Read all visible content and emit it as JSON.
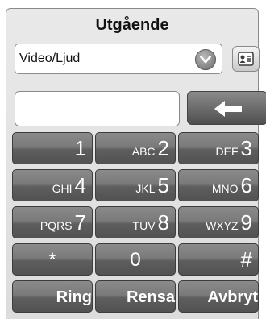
{
  "title": "Utgående",
  "call_type": {
    "selected": "Video/Ljud"
  },
  "number_input": {
    "value": "",
    "placeholder": ""
  },
  "icons": {
    "dropdown": "chevron-down-icon",
    "contacts": "contact-card-icon",
    "backspace": "backspace-arrow-icon"
  },
  "keypad": {
    "k1": {
      "letters": "",
      "digit": "1"
    },
    "k2": {
      "letters": "ABC",
      "digit": "2"
    },
    "k3": {
      "letters": "DEF",
      "digit": "3"
    },
    "k4": {
      "letters": "GHI",
      "digit": "4"
    },
    "k5": {
      "letters": "JKL",
      "digit": "5"
    },
    "k6": {
      "letters": "MNO",
      "digit": "6"
    },
    "k7": {
      "letters": "PQRS",
      "digit": "7"
    },
    "k8": {
      "letters": "TUV",
      "digit": "8"
    },
    "k9": {
      "letters": "WXYZ",
      "digit": "9"
    },
    "star": "*",
    "zero": "0",
    "hash": "#"
  },
  "actions": {
    "ring": "Ring",
    "clear": "Rensa",
    "cancel": "Avbryt"
  }
}
